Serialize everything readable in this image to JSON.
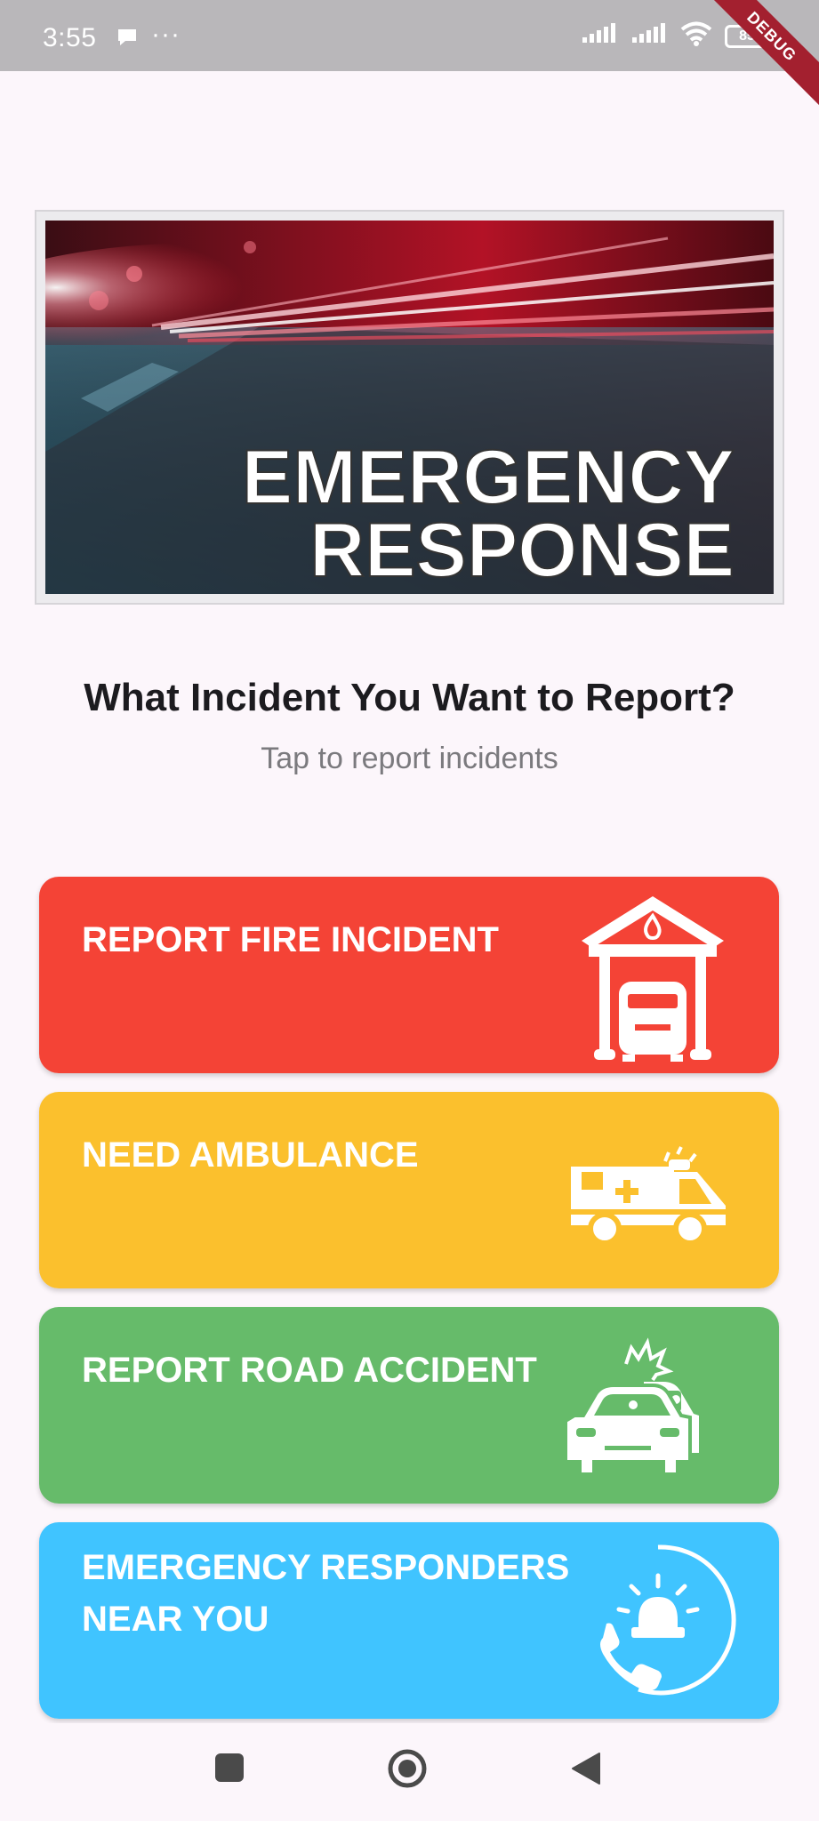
{
  "status_bar": {
    "time": "3:55",
    "dots": "···",
    "battery": "85",
    "debug_ribbon": "DEBUG"
  },
  "banner": {
    "line1": "EMERGENCY",
    "line2": "RESPONSE"
  },
  "header": {
    "title": "What Incident You Want to Report?",
    "subtitle": "Tap to report incidents"
  },
  "cards": [
    {
      "label": "REPORT FIRE INCIDENT",
      "color": "#f44336",
      "icon": "fire-station-icon"
    },
    {
      "label": "NEED AMBULANCE",
      "color": "#fbc02d",
      "icon": "ambulance-icon"
    },
    {
      "label": "REPORT ROAD ACCIDENT",
      "color": "#66bb6a",
      "icon": "car-crash-icon"
    },
    {
      "label_line1": "EMERGENCY RESPONDERS",
      "label_line2": "NEAR YOU",
      "color": "#40c4ff",
      "icon": "phone-siren-icon"
    }
  ],
  "nav": {
    "recents": "square-icon",
    "home": "circle-icon",
    "back": "triangle-back-icon"
  }
}
